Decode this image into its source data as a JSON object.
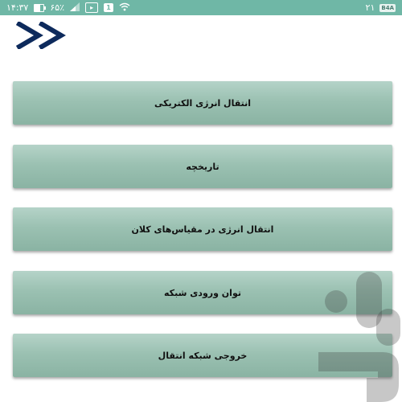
{
  "status_bar": {
    "time": "۱۴:۳۷",
    "battery_percent": "۶۵٪",
    "battery_level": 0.65,
    "sim_label": "1",
    "notification_count": "۲۱",
    "badge_text": "B4A",
    "background_color": "#6fb7a6"
  },
  "header": {
    "nav_icon": "double-chevron-right-icon",
    "icon_color": "#0d2a5c"
  },
  "menu": {
    "items": [
      {
        "label": "انتقال انرژی الکتریکی"
      },
      {
        "label": "تاریخچه"
      },
      {
        "label": "انتقال انرژی در مقیاس‌های کلان"
      },
      {
        "label": "توان ورودی شبکه"
      },
      {
        "label": "خروجی شبکه انتقال"
      }
    ],
    "button_color": "#9bc1b2"
  },
  "watermark": {
    "icon": "bazaar-logo-icon"
  }
}
